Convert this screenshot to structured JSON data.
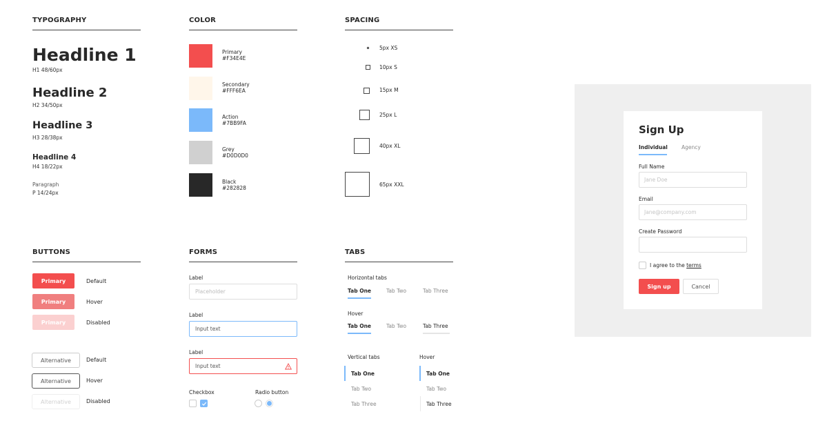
{
  "typography": {
    "title": "TYPOGRAPHY",
    "h1": {
      "text": "Headline 1",
      "spec": "H1 48/60px"
    },
    "h2": {
      "text": "Headline 2",
      "spec": "H2 34/50px"
    },
    "h3": {
      "text": "Headline 3",
      "spec": "H3 28/38px"
    },
    "h4": {
      "text": "Headline 4",
      "spec": "H4 18/22px"
    },
    "p": {
      "text": "Paragraph",
      "spec": "P 14/24px"
    }
  },
  "color": {
    "title": "COLOR",
    "swatches": [
      {
        "name": "Primary",
        "hex": "#F34E4E"
      },
      {
        "name": "Secondary",
        "hex": "#FFF6EA"
      },
      {
        "name": "Action",
        "hex": "#7BB9FA"
      },
      {
        "name": "Grey",
        "hex": "#D0D0D0"
      },
      {
        "name": "Black",
        "hex": "#282828"
      }
    ]
  },
  "spacing": {
    "title": "SPACING",
    "items": [
      {
        "label": "5px XS"
      },
      {
        "label": "10px S"
      },
      {
        "label": "15px M"
      },
      {
        "label": "25px L"
      },
      {
        "label": "40px XL"
      },
      {
        "label": "65px XXL"
      }
    ]
  },
  "buttons": {
    "title": "BUTTONS",
    "primary_label": "Primary",
    "alternative_label": "Alternative",
    "states": {
      "default": "Default",
      "hover": "Hover",
      "disabled": "Disabled"
    }
  },
  "forms": {
    "title": "FORMS",
    "label": "Label",
    "placeholder": "Placeholder",
    "input_text": "Input text",
    "checkbox": "Checkbox",
    "radio": "Radio button"
  },
  "tabs": {
    "title": "TABS",
    "horizontal": "Horizontal tabs",
    "hover": "Hover",
    "vertical": "Vertical tabs",
    "items": [
      "Tab One",
      "Tab Two",
      "Tab Three"
    ]
  },
  "signup": {
    "title": "Sign Up",
    "tabs": [
      "Individual",
      "Agency"
    ],
    "full_name_label": "Full Name",
    "full_name_placeholder": "Jane Doe",
    "email_label": "Email",
    "email_placeholder": "Jane@company.com",
    "password_label": "Create Password",
    "password_placeholder": "",
    "agree_text": "I agree to the",
    "terms_link": "terms",
    "signup_button": "Sign up",
    "cancel_button": "Cancel"
  }
}
